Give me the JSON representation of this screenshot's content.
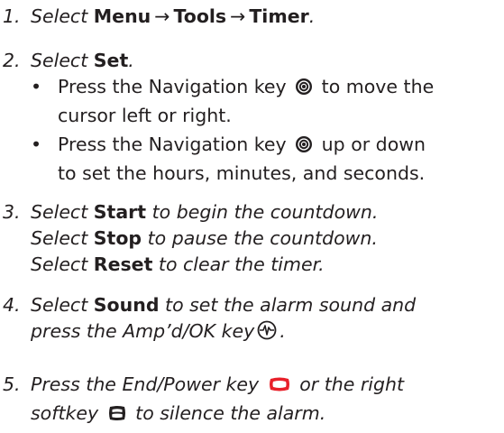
{
  "steps": [
    {
      "number": "1.",
      "select": "Select",
      "menu": "Menu",
      "arrow1": "→",
      "tools": "Tools",
      "arrow2": "→",
      "timer": "Timer",
      "period": "."
    },
    {
      "number": "2.",
      "select": "Select",
      "set": "Set",
      "period": ".",
      "bullets": [
        {
          "bullet": "•",
          "line1_pre": "Press the Navigation key",
          "line1_post": "to move the",
          "line2": "cursor left or right.",
          "icon": "navigation-key-icon"
        },
        {
          "bullet": "•",
          "line1_pre": "Press the Navigation key",
          "line1_post": "up or down",
          "line2": "to set the hours, minutes, and seconds.",
          "icon": "navigation-key-icon"
        }
      ]
    },
    {
      "number": "3.",
      "line1_select": "Select",
      "line1_bold": "Start",
      "line1_rest": "to begin the countdown.",
      "line2_select": "Select",
      "line2_bold": "Stop",
      "line2_rest": "to pause the countdown.",
      "line3_select": "Select",
      "line3_bold": "Reset",
      "line3_rest": "to clear the timer."
    },
    {
      "number": "4.",
      "line1_select": "Select",
      "line1_bold": "Sound",
      "line1_rest": "to set the alarm sound and",
      "line2_pre": "press the Amp’d/OK key",
      "line2_post": ".",
      "icon": "amp-ok-key-icon"
    },
    {
      "number": "5.",
      "line1_pre": "Press the End/Power key",
      "line1_post": "or the right",
      "line2_pre": "softkey",
      "line2_post": "to silence the alarm.",
      "icon_end": "end-power-key-icon",
      "icon_softkey": "right-softkey-icon",
      "end_key_color": "#e8202a"
    }
  ]
}
